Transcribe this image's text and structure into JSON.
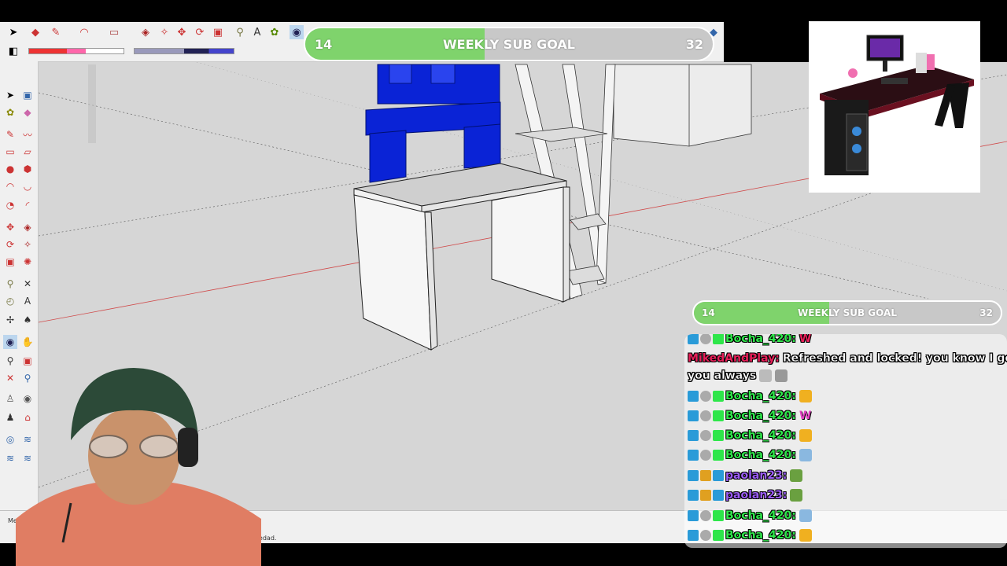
{
  "goal_top": {
    "current": "14",
    "label": "WEEKLY SUB GOAL",
    "target": "32",
    "progress": 0.44
  },
  "goal_side": {
    "current": "14",
    "label": "WEEKLY SUB GOAL",
    "target": "32",
    "progress": 0.44
  },
  "status": {
    "left_label": "Medidas",
    "hint": "ravedad."
  },
  "colors": {
    "goal_fill": "#7fd36c",
    "goal_bg": "#c8c8c8",
    "viewport_bg": "#d6d6d6",
    "desk_blue": "#0a23d6"
  },
  "chat": {
    "messages": [
      {
        "user": "Bocha_420:",
        "text": "W",
        "color": "green"
      },
      {
        "user": "MikedAndPlay:",
        "text": "Refreshed and locked! you know I got",
        "text2": "you always",
        "color": "red"
      },
      {
        "user": "Bocha_420:",
        "text": "",
        "color": "green"
      },
      {
        "user": "Bocha_420:",
        "text": "W",
        "color": "green"
      },
      {
        "user": "Bocha_420:",
        "text": "",
        "color": "green"
      },
      {
        "user": "Bocha_420:",
        "text": "",
        "color": "green"
      },
      {
        "user": "paolan23:",
        "text": "",
        "color": "purple"
      },
      {
        "user": "paolan23:",
        "text": "",
        "color": "purple"
      },
      {
        "user": "Bocha_420:",
        "text": "",
        "color": "green"
      },
      {
        "user": "Bocha_420:",
        "text": "",
        "color": "green"
      }
    ]
  }
}
